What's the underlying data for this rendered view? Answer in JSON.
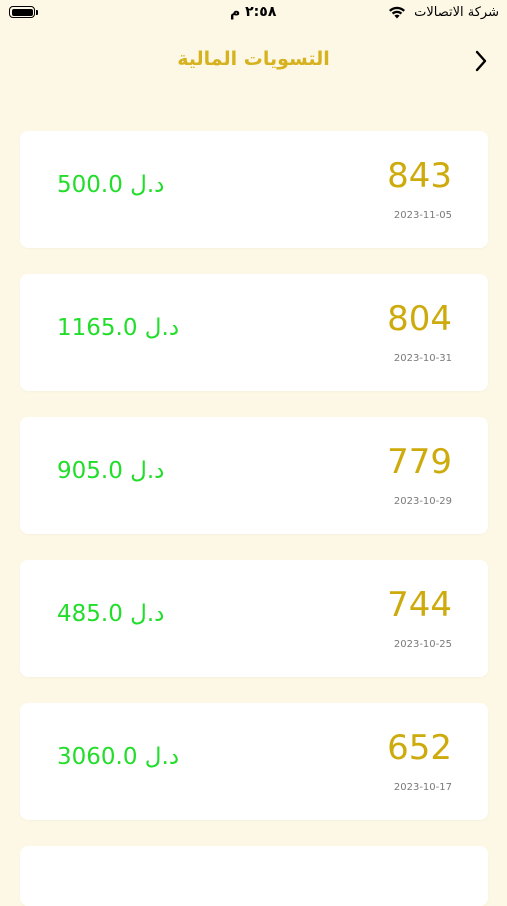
{
  "status_bar": {
    "carrier": "شركة الاتصالات",
    "time": "٢:٥٨ م",
    "battery_level": 1.0,
    "icons": [
      "wifi-icon",
      "battery-icon"
    ]
  },
  "header": {
    "title": "التسويات المالية",
    "back_icon": "chevron-right-icon"
  },
  "colors": {
    "background": "#fdf8e5",
    "title": "#d6b220",
    "number": "#ceab0c",
    "amount": "#22dd2a",
    "date": "#7a7a7a",
    "card": "#ffffff"
  },
  "settlements": [
    {
      "number": "843",
      "date": "2023-11-05",
      "amount": "500.0 د.ل"
    },
    {
      "number": "804",
      "date": "2023-10-31",
      "amount": "1165.0 د.ل"
    },
    {
      "number": "779",
      "date": "2023-10-29",
      "amount": "905.0 د.ل"
    },
    {
      "number": "744",
      "date": "2023-10-25",
      "amount": "485.0 د.ل"
    },
    {
      "number": "652",
      "date": "2023-10-17",
      "amount": "3060.0 د.ل"
    }
  ]
}
